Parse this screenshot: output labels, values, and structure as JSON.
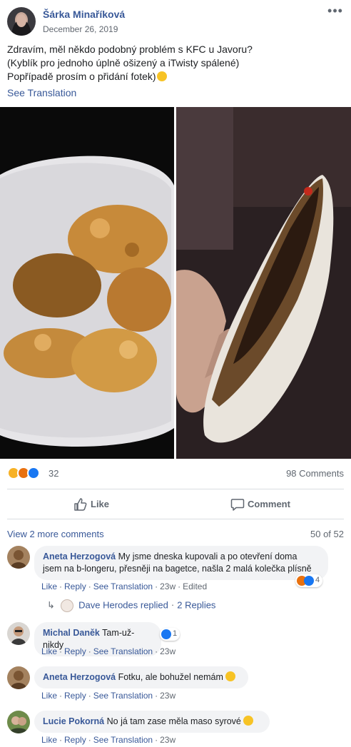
{
  "post": {
    "author": "Šárka Minaříková",
    "date": "December 26, 2019",
    "more_icon": "more-horizontal-icon",
    "text_lines": [
      "Zdravím, měl někdo podobný problém s KFC u Javoru?",
      "(Kyblík pro jednoho úplně ošizený a iTwisty spálené)",
      "Popřípadě prosím o přidání fotek)"
    ],
    "see_translation": "See Translation"
  },
  "stats": {
    "reaction_count": "32",
    "comments_count": "98 Comments",
    "reaction_icons": [
      "haha-icon",
      "angry-icon",
      "like-icon"
    ]
  },
  "actions": {
    "like": "Like",
    "comment": "Comment"
  },
  "comments_section": {
    "view_more": "View 2 more comments",
    "pager": "50 of 52"
  },
  "comments": [
    {
      "author": "Aneta Herzogová",
      "text_line1": "My jsme dneska kupovali a po otevření doma",
      "text_line2": "jsem na b-longeru, přesněji na bagetce, našla 2 malá kolečka plísně",
      "like": "Like",
      "reply": "Reply",
      "translate": "See Translation",
      "time": "23w",
      "edited": "Edited",
      "reaction_count": "4"
    },
    {
      "author": "Michal Daněk",
      "text": "Tam-už-nikdy",
      "like": "Like",
      "reply": "Reply",
      "translate": "See Translation",
      "time": "23w",
      "reaction_count": "1"
    },
    {
      "author": "Aneta Herzogová",
      "text": "Fotku, ale bohužel nemám",
      "like": "Like",
      "reply": "Reply",
      "translate": "See Translation",
      "time": "23w"
    },
    {
      "author": "Lucie Pokorná",
      "text": "No já tam zase měla maso syrové",
      "like": "Like",
      "reply": "Reply",
      "translate": "See Translation",
      "time": "23w"
    }
  ],
  "reply_summary": {
    "text": "Dave Herodes replied",
    "count": "2 Replies"
  },
  "colors": {
    "link": "#385898",
    "muted": "#606770",
    "bubble": "#f2f3f5",
    "like_blue": "#1877f2",
    "angry": "#e9710f",
    "haha": "#f7b125"
  }
}
